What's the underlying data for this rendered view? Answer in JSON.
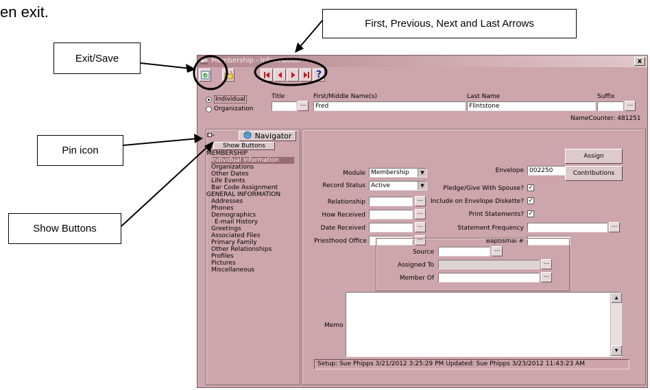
{
  "page": {
    "top_text": "en exit."
  },
  "callouts": {
    "exit_save": "Exit/Save",
    "arrows": "First, Previous, Next and Last Arrows",
    "pin_icon": "Pin icon",
    "show_buttons": "Show Buttons"
  },
  "window": {
    "title": "Membership - Information",
    "close_label": "x"
  },
  "toolbar": {
    "help_label": "?"
  },
  "name_entry": {
    "type_options": [
      {
        "label": "Individual",
        "selected": true
      },
      {
        "label": "Organization",
        "selected": false
      }
    ],
    "title_label": "Title",
    "first_label": "First/Middle Name(s)",
    "first_value": "Fred",
    "last_label": "Last Name",
    "last_value": "Flintstone",
    "suffix_label": "Suffix",
    "name_counter": "NameCounter: 481251"
  },
  "navigator": {
    "title": "Navigator",
    "show_buttons": "Show Buttons",
    "items": [
      "MEMBERSHIP",
      "Individual Information",
      "Organizations",
      "Other Dates",
      "Life Events",
      "Bar Code Assignment",
      "GENERAL INFORMATION",
      "Addresses",
      "Phones",
      "Demographics",
      "E-mail History",
      "Greetings",
      "Associated Files",
      "Primary Family",
      "Other Relationships",
      "Profiles",
      "Pictures",
      "Miscellaneous"
    ],
    "selected_index": 1
  },
  "form": {
    "module_label": "Module",
    "module_value": "Membership",
    "record_status_label": "Record Status",
    "record_status_value": "Active",
    "relationship_label": "Relationship",
    "how_received_label": "How Received",
    "date_received_label": "Date Received",
    "priesthood_label": "Priesthood Office",
    "envelope_label": "Envelope",
    "envelope_value": "002250",
    "pledge_label": "Pledge/Give With Spouse?",
    "pledge_checked": true,
    "diskette_label": "Include on Envelope Diskette?",
    "diskette_checked": true,
    "print_label": "Print Statements?",
    "print_checked": true,
    "statement_freq_label": "Statement Frequency",
    "baptismal_label": "Baptismal #",
    "assign_button": "Assign",
    "contributions_button": "Contributions",
    "source_label": "Source",
    "assigned_to_label": "Assigned To",
    "member_of_label": "Member Of",
    "memo_label": "Memo",
    "status_text": "Setup: Sue Phipps 3/21/2012 3:25:29 PM  Updated: Sue Phipps 3/23/2012 11:43:23 AM"
  },
  "colors": {
    "window_bg": "#cda5ac",
    "nav_selected": "#9a6b73",
    "first_last_arrow": "#c4161c",
    "prev_next_arrow": "#c4161c"
  }
}
